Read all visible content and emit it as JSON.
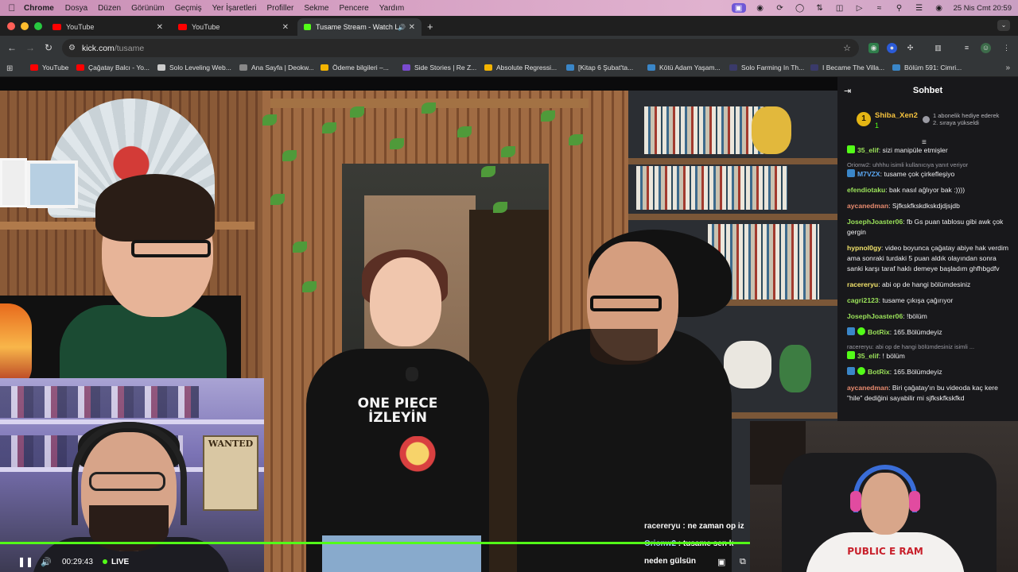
{
  "menubar": {
    "app_name": "Chrome",
    "items": [
      "Dosya",
      "Düzen",
      "Görünüm",
      "Geçmiş",
      "Yer İşaretleri",
      "Profiller",
      "Sekme",
      "Pencere",
      "Yardım"
    ],
    "clock": "25 Nis Cmt  20:59"
  },
  "tabs": [
    {
      "title": "YouTube",
      "favicon_color": "#ff0000"
    },
    {
      "title": "YouTube",
      "favicon_color": "#ff0000"
    },
    {
      "title": "Tusame Stream - Watch L",
      "favicon_color": "#53fc18"
    }
  ],
  "toolbar": {
    "url_host": "kick.com",
    "url_path": "/tusame"
  },
  "bookmarks": [
    {
      "label": "YouTube",
      "color": "#ff0000"
    },
    {
      "label": "Çağatay Balcı - Yo...",
      "color": "#ff0000"
    },
    {
      "label": "Solo Leveling Web...",
      "color": "#cccccc"
    },
    {
      "label": "Ana Sayfa | Deokw...",
      "color": "#888888"
    },
    {
      "label": "Ödeme bilgileri –...",
      "color": "#f4b400"
    },
    {
      "label": "Side Stories | Re Z...",
      "color": "#7a4bd0"
    },
    {
      "label": "Absolute Regressi...",
      "color": "#f4b400"
    },
    {
      "label": "[Kitap 6 Şubat'ta...",
      "color": "#3a86c8"
    },
    {
      "label": "Kötü Adam Yaşam...",
      "color": "#3a86c8"
    },
    {
      "label": "Solo Farming In Th...",
      "color": "#3a3a6a"
    },
    {
      "label": "I Became The Villa...",
      "color": "#3a3a6a"
    },
    {
      "label": "Bölüm 591: Cimri...",
      "color": "#3a86c8"
    }
  ],
  "stream": {
    "shirt_text": "ONE PIECE İZLEYİN",
    "poster_text": "WANTED",
    "streamer_shirt_text": "PUBLIC E RAM",
    "overlay_chat": [
      {
        "user": "racereryu",
        "text": "ne zaman op iz"
      },
      {
        "user": "Orionw2",
        "text": "tusame sen k"
      },
      {
        "user": "",
        "text": "neden gülsün"
      }
    ]
  },
  "player": {
    "time": "00:29:43",
    "live_label": "LIVE",
    "accent": "#53fc18"
  },
  "chat": {
    "title": "Sohbet",
    "pinned": {
      "rank": "1",
      "user": "Shiba_Xen2",
      "count": "1",
      "note": "1 abonelik hediye ederek 2. sıraya yükseldi"
    },
    "messages": [
      {
        "reply": "",
        "user": "35_elif",
        "color": "#9be25a",
        "badge_color": "#53fc18",
        "text": "sizi manipüle etmişler"
      },
      {
        "reply": "Orionw2: uhhhu isimli kullanıcıya yanıt veriyor",
        "user": "M7VZX",
        "color": "#5aa7f2",
        "badge_color": "#3a86c8",
        "text": "tusame çok çirkefleşiyo"
      },
      {
        "reply": "",
        "user": "efendiotaku",
        "color": "#9be25a",
        "badge_color": "",
        "text": "bak nasıl ağlıyor bak :))))"
      },
      {
        "reply": "",
        "user": "aycanedman",
        "color": "#e88b6f",
        "badge_color": "",
        "text": "Sjfkskfkskdkskdjdjsjdb"
      },
      {
        "reply": "",
        "user": "JosephJoaster06",
        "color": "#9be25a",
        "badge_color": "",
        "text": "fb Gs puan tablosu gibi awk çok gergin"
      },
      {
        "reply": "",
        "user": "hypnol0gy",
        "color": "#f2e36b",
        "badge_color": "",
        "text": "video boyunca çağatay abiye hak verdim ama sonraki turdaki 5 puan aldık olayından sonra sanki karşı taraf haklı demeye başladım ghfhbgdfv"
      },
      {
        "reply": "",
        "user": "racereryu",
        "color": "#f2e36b",
        "badge_color": "",
        "text": "abi op de hangi bölümdesiniz"
      },
      {
        "reply": "",
        "user": "cagri2123",
        "color": "#9be25a",
        "badge_color": "",
        "text": "tusame çıkışa çağırıyor"
      },
      {
        "reply": "",
        "user": "JosephJoaster06",
        "color": "#9be25a",
        "badge_color": "",
        "text": "!bölüm"
      },
      {
        "reply": "",
        "user": "BotRix",
        "color": "#9be25a",
        "badge_color": "#3a86c8",
        "text": "165.Bölümdeyiz"
      },
      {
        "reply": "racereryu: abi op de hangi bölümdesiniz isimli ...",
        "user": "35_elif",
        "color": "#9be25a",
        "badge_color": "#53fc18",
        "text": "! bölüm"
      },
      {
        "reply": "",
        "user": "BotRix",
        "color": "#9be25a",
        "badge_color": "#3a86c8",
        "text": "165.Bölümdeyiz"
      },
      {
        "reply": "",
        "user": "aycanedman",
        "color": "#e88b6f",
        "badge_color": "",
        "text": "Biri çağatay'ın bu videoda kaç kere \"hile\" dediğini sayabilir mi sjfkskfkskfkd"
      }
    ]
  }
}
